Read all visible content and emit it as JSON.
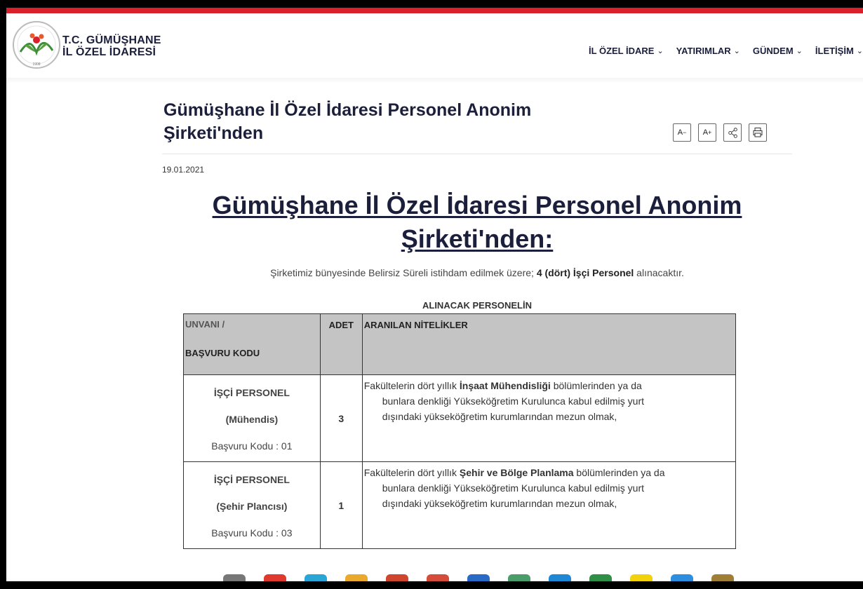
{
  "header": {
    "brand_line1": "T.C. GÜMÜŞHANE",
    "brand_line2": "İL ÖZEL İDARESİ",
    "logo_text": "GÜMÜŞHANE İL ÖZEL İDARESİ",
    "nav": [
      {
        "label": "İL ÖZEL İDARE",
        "icon": "chevron-down-icon"
      },
      {
        "label": "YATIRIMLAR",
        "icon": "chevron-down-icon"
      },
      {
        "label": "GÜNDEM",
        "icon": "chevron-down-icon"
      },
      {
        "label": "İLETİŞİM",
        "icon": "chevron-down-icon"
      }
    ]
  },
  "article": {
    "title": "Gümüşhane İl Özel İdaresi Personel Anonim Şirketi'nden",
    "tools": {
      "decrease": "A",
      "increase": "A"
    },
    "date": "19.01.2021",
    "heading": "Gümüşhane İl Özel İdaresi Personel Anonim Şirketi'nden:",
    "intro_prefix": "Şirketimiz bünyesinde Belirsiz Süreli istihdam edilmek üzere; ",
    "intro_bold": "4 (dört) İşçi Personel",
    "intro_suffix": " alınacaktır.",
    "table_caption": "ALINACAK PERSONELİN",
    "table": {
      "col1_line1": "UNVANI /",
      "col1_line2": "BAŞVURU KODU",
      "col2": "ADET",
      "col3": "ARANILAN NİTELİKLER",
      "rows": [
        {
          "title": "İŞÇİ PERSONEL",
          "subtitle": "(Mühendis)",
          "code": "Başvuru Kodu : 01",
          "count": "3",
          "desc_prefix": "Fakültelerin dört yıllık ",
          "desc_bold": "İnşaat Mühendisliği",
          "desc_suffix": " bölümlerinden ya da",
          "desc_line2": "bunlara denkliği Yükseköğretim Kurulunca kabul edilmiş yurt",
          "desc_line3": "dışındaki yükseköğretim kurumlarından mezun olmak,"
        },
        {
          "title": "İŞÇİ PERSONEL",
          "subtitle": "(Şehir Plancısı)",
          "code": "Başvuru Kodu : 03",
          "count": "1",
          "desc_prefix": "Fakültelerin dört yıllık ",
          "desc_bold": "Şehir ve Bölge Planlama",
          "desc_suffix": " bölümlerinden ya da",
          "desc_line2": "bunlara denkliği Yükseköğretim Kurulunca kabul edilmiş yurt",
          "desc_line3": "dışındaki yükseköğretim kurumlarından mezun olmak,"
        }
      ]
    }
  },
  "colors": {
    "accent_red": "#d81f2a",
    "navy": "#1b1f3b",
    "table_header": "#c4c4c4"
  }
}
